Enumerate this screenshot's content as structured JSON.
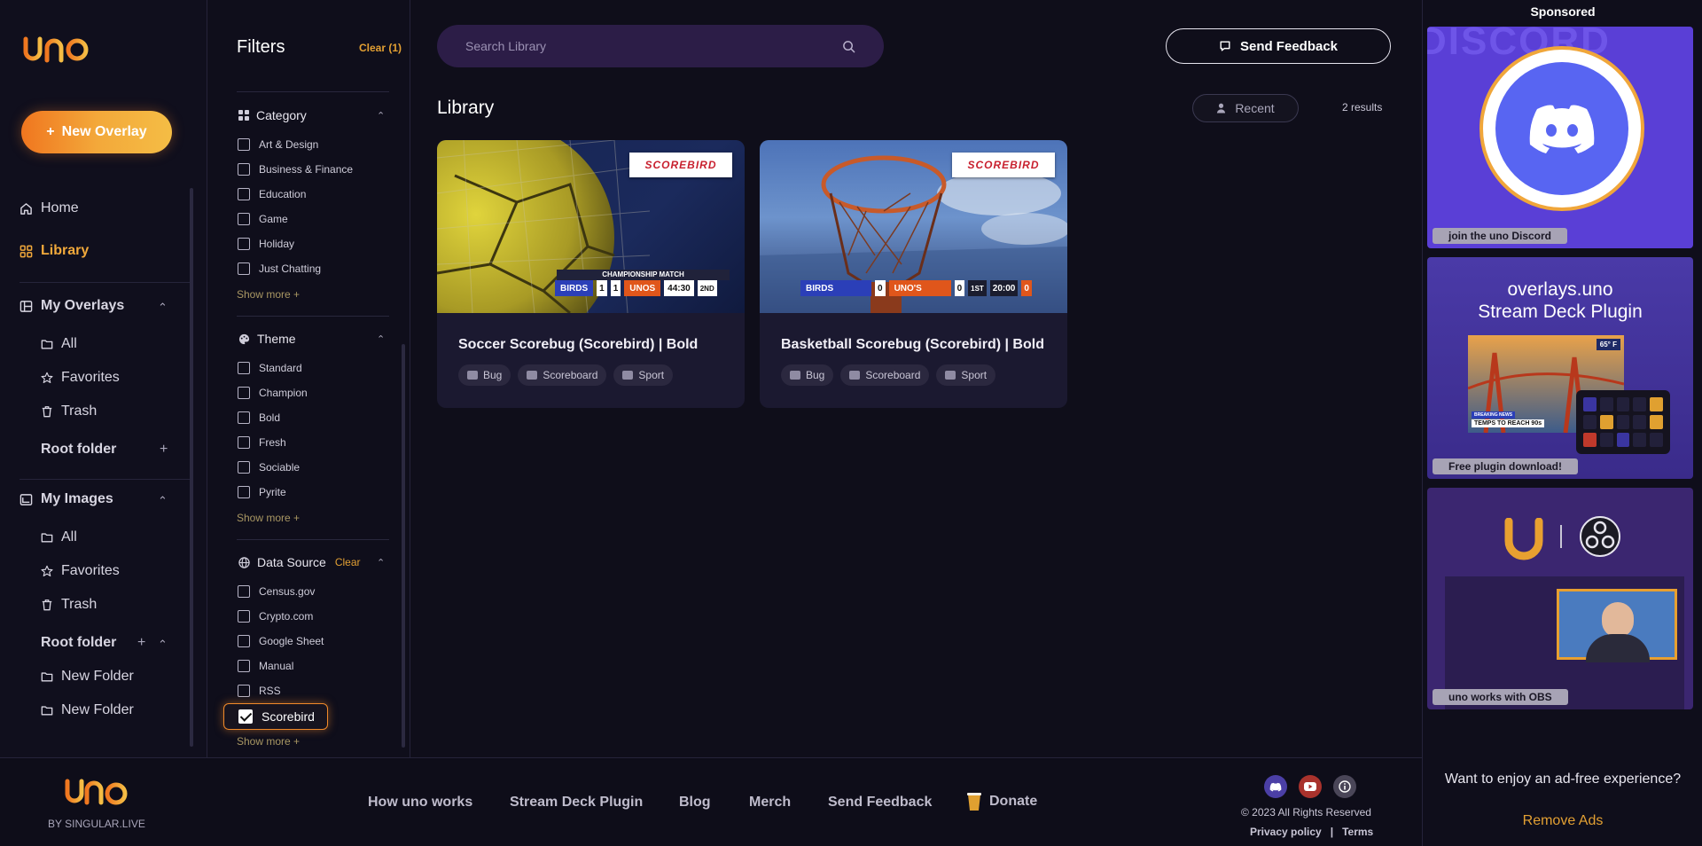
{
  "app": {
    "logo": "uno",
    "byline": "BY SINGULAR.LIVE"
  },
  "nav": {
    "new_overlay": "New Overlay",
    "home": "Home",
    "library": "Library",
    "my_overlays": "My Overlays",
    "overlays_all": "All",
    "overlays_favorites": "Favorites",
    "overlays_trash": "Trash",
    "overlays_root": "Root folder",
    "my_images": "My Images",
    "images_all": "All",
    "images_favorites": "Favorites",
    "images_trash": "Trash",
    "images_root": "Root folder",
    "folder1": "New Folder",
    "folder2": "New Folder"
  },
  "filters": {
    "title": "Filters",
    "clear_all": "Clear (1)",
    "category": {
      "label": "Category",
      "items": [
        "Art & Design",
        "Business & Finance",
        "Education",
        "Game",
        "Holiday",
        "Just Chatting"
      ]
    },
    "theme": {
      "label": "Theme",
      "items": [
        "Standard",
        "Champion",
        "Bold",
        "Fresh",
        "Sociable",
        "Pyrite"
      ]
    },
    "data_source": {
      "label": "Data Source",
      "clear": "Clear",
      "items": [
        "Census.gov",
        "Crypto.com",
        "Google Sheet",
        "Manual",
        "RSS"
      ],
      "checked": "Scorebird"
    },
    "show_more": "Show more +"
  },
  "search": {
    "placeholder": "Search Library"
  },
  "header": {
    "feedback": "Send Feedback"
  },
  "library": {
    "title": "Library",
    "sort": "Recent",
    "results": "2 results",
    "cards": [
      {
        "title": "Soccer Scorebug (Scorebird) | Bold",
        "tags": [
          "Bug",
          "Scoreboard",
          "Sport"
        ],
        "sponsor_logo": "SCOREBIRD",
        "match": "CHAMPIONSHIP MATCH",
        "team_a": "BIRDS",
        "score_a": "1",
        "score_b": "1",
        "team_b": "UNOS",
        "clock": "44:30",
        "period": "2ND"
      },
      {
        "title": "Basketball Scorebug (Scorebird) | Bold",
        "tags": [
          "Bug",
          "Scoreboard",
          "Sport"
        ],
        "sponsor_logo": "SCOREBIRD",
        "team_a": "BIRDS",
        "score_a": "0",
        "team_b": "UNO'S",
        "score_b": "0",
        "period": "1ST",
        "clock": "20:00",
        "extra": "0"
      }
    ]
  },
  "sponsored": {
    "label": "Sponsored",
    "ads": [
      {
        "caption": "join the uno Discord",
        "text": "DISCORD"
      },
      {
        "caption": "Free plugin download!",
        "title": "overlays.uno\nStream Deck Plugin",
        "temp": "65° F",
        "news_label": "BREAKING NEWS",
        "news": "TEMPS TO REACH 90s"
      },
      {
        "caption": "uno works with OBS"
      }
    ],
    "adfree": "Want to enjoy an ad-free experience?",
    "remove": "Remove Ads"
  },
  "footer": {
    "links": [
      "How uno works",
      "Stream Deck Plugin",
      "Blog",
      "Merch",
      "Send Feedback",
      "Donate"
    ],
    "copyright": "© 2023 All Rights Reserved",
    "privacy": "Privacy policy",
    "separator": "|",
    "terms": "Terms"
  },
  "colors": {
    "accent": "#f2a93b",
    "primary_bg": "#0f0e1a",
    "search_bg": "#2c1d47",
    "discord": "#5865f2",
    "youtube": "#e53935"
  }
}
